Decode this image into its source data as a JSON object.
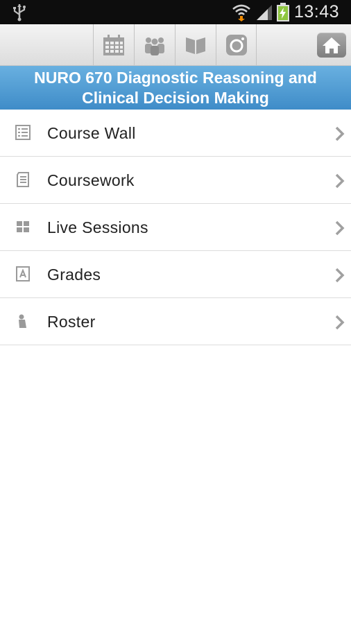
{
  "status_bar": {
    "time": "13:43",
    "icons": [
      "usb-icon",
      "wifi-icon",
      "signal-icon",
      "battery-charging-icon"
    ]
  },
  "toolbar": {
    "buttons": [
      "calendar-icon",
      "people-icon",
      "book-icon",
      "camera-icon"
    ],
    "home": "home-icon"
  },
  "course": {
    "title": "NURO 670 Diagnostic Reasoning and Clinical Decision Making"
  },
  "menu": {
    "items": [
      {
        "label": "Course Wall",
        "icon": "list-icon"
      },
      {
        "label": "Coursework",
        "icon": "document-icon"
      },
      {
        "label": "Live Sessions",
        "icon": "grid-icon"
      },
      {
        "label": "Grades",
        "icon": "grade-icon"
      },
      {
        "label": "Roster",
        "icon": "person-icon"
      }
    ]
  },
  "colors": {
    "banner": "#4a97d0",
    "status_bar": "#0d0d0d",
    "toolbar_icon": "#9a9a9a",
    "battery": "#8ec63f",
    "wifi_arrow": "#f08a00"
  }
}
